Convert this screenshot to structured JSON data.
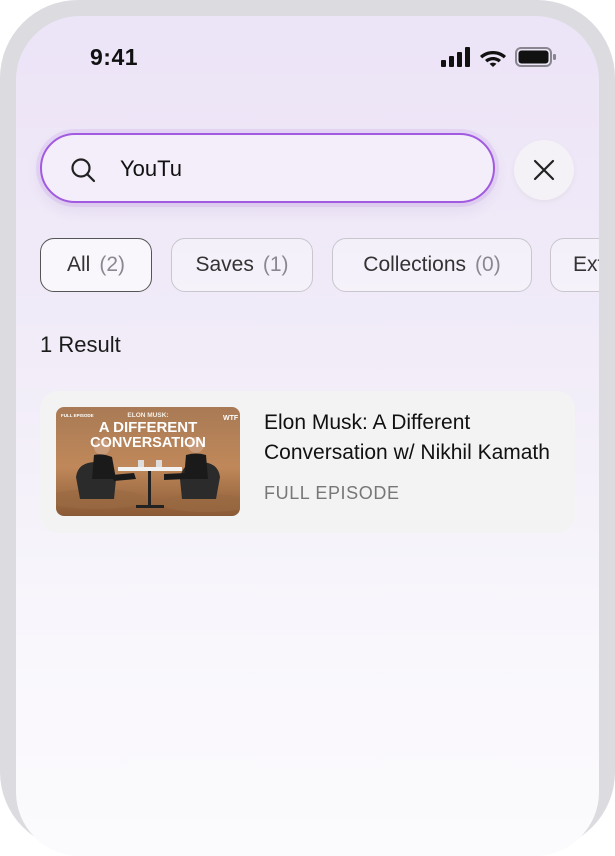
{
  "status_bar": {
    "time": "9:41"
  },
  "search": {
    "value": "YouTu"
  },
  "filters": [
    {
      "label": "All",
      "count": "(2)"
    },
    {
      "label": "Saves",
      "count": "(1)"
    },
    {
      "label": "Collections",
      "count": "(0)"
    },
    {
      "label": "Extr",
      "count": ""
    }
  ],
  "results": {
    "count_label": "1 Result",
    "items": [
      {
        "title": "Elon Musk: A Different Conversation w/ Nikhil Kamath",
        "type": "FULL EPISODE",
        "thumbnail": {
          "top_label": "ELON MUSK:",
          "line1": "A DIFFERENT",
          "line2": "CONVERSATION",
          "badge_left": "FULL EPISODE",
          "badge_right": "WTF"
        }
      }
    ]
  },
  "colors": {
    "accent": "#a25ae0",
    "chip_border": "#c9c6cf",
    "card_bg": "#f3f3f3"
  }
}
